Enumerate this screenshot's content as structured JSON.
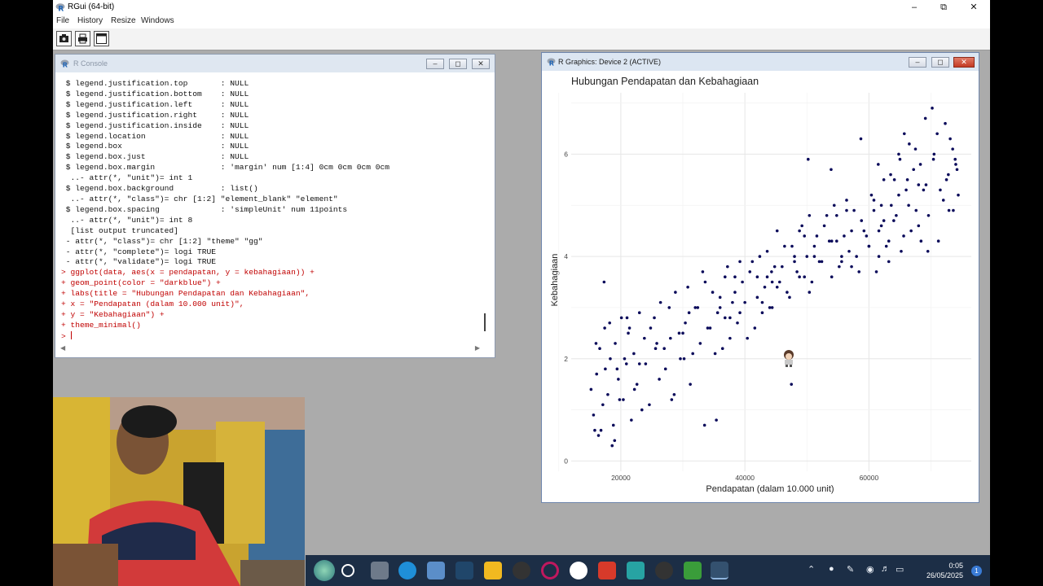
{
  "app": {
    "title": "RGui (64-bit)",
    "menu": [
      "File",
      "History",
      "Resize",
      "Windows"
    ],
    "toolbar_icons": [
      "open-script-icon",
      "print-icon",
      "console-window-icon"
    ]
  },
  "console": {
    "title": "R Console",
    "lines": [
      {
        "text": " $ legend.justification.top       : NULL",
        "kind": "out"
      },
      {
        "text": " $ legend.justification.bottom    : NULL",
        "kind": "out"
      },
      {
        "text": " $ legend.justification.left      : NULL",
        "kind": "out"
      },
      {
        "text": " $ legend.justification.right     : NULL",
        "kind": "out"
      },
      {
        "text": " $ legend.justification.inside    : NULL",
        "kind": "out"
      },
      {
        "text": " $ legend.location                : NULL",
        "kind": "out"
      },
      {
        "text": " $ legend.box                     : NULL",
        "kind": "out"
      },
      {
        "text": " $ legend.box.just                : NULL",
        "kind": "out"
      },
      {
        "text": " $ legend.box.margin              : 'margin' num [1:4] 0cm 0cm 0cm 0cm",
        "kind": "out"
      },
      {
        "text": "  ..- attr(*, \"unit\")= int 1",
        "kind": "out"
      },
      {
        "text": " $ legend.box.background          : list()",
        "kind": "out"
      },
      {
        "text": "  ..- attr(*, \"class\")= chr [1:2] \"element_blank\" \"element\"",
        "kind": "out"
      },
      {
        "text": " $ legend.box.spacing             : 'simpleUnit' num 11points",
        "kind": "out"
      },
      {
        "text": "  ..- attr(*, \"unit\")= int 8",
        "kind": "out"
      },
      {
        "text": "  [list output truncated]",
        "kind": "out"
      },
      {
        "text": " - attr(*, \"class\")= chr [1:2] \"theme\" \"gg\"",
        "kind": "out"
      },
      {
        "text": " - attr(*, \"complete\")= logi TRUE",
        "kind": "out"
      },
      {
        "text": " - attr(*, \"validate\")= logi TRUE",
        "kind": "out"
      },
      {
        "text": "> ggplot(data, aes(x = pendapatan, y = kebahagiaan)) +",
        "kind": "cmd"
      },
      {
        "text": "+ geom_point(color = \"darkblue\") +",
        "kind": "cmd"
      },
      {
        "text": "+ labs(title = \"Hubungan Pendapatan dan Kebahagiaan\",",
        "kind": "cmd"
      },
      {
        "text": "+ x = \"Pendapatan (dalam 10.000 unit)\",",
        "kind": "cmd"
      },
      {
        "text": "+ y = \"Kebahagiaan\") +",
        "kind": "cmd"
      },
      {
        "text": "+ theme_minimal()",
        "kind": "cmd"
      }
    ],
    "prompt": "> "
  },
  "graphics": {
    "title": "R Graphics: Device 2 (ACTIVE)"
  },
  "chart_data": {
    "type": "scatter",
    "title": "Hubungan Pendapatan dan Kebahagiaan",
    "xlabel": "Pendapatan (dalam 10.000 unit)",
    "ylabel": "Kebahagiaan",
    "xlim": [
      12000,
      76500
    ],
    "ylim": [
      -0.2,
      7.2
    ],
    "xticks": [
      20000,
      40000,
      60000
    ],
    "xtick_labels": [
      "20000",
      "40000",
      "60000"
    ],
    "yticks": [
      0,
      2,
      4,
      6
    ],
    "ytick_labels": [
      "0",
      "2",
      "4",
      "6"
    ],
    "point_color": "#0a0a5a",
    "grid": true,
    "series": [
      {
        "x": [
          15200,
          15600,
          16100,
          16600,
          17100,
          17400,
          17900,
          18300,
          18800,
          19100,
          19600,
          20100,
          20400,
          20900,
          21200,
          21700,
          22100,
          22600,
          23000,
          23400,
          16000,
          16800,
          17500,
          18200,
          19000,
          19800,
          20600,
          21400,
          22200,
          23000,
          23800,
          24600,
          25400,
          26200,
          27000,
          27800,
          28600,
          29400,
          30200,
          31000,
          24000,
          24800,
          25600,
          26400,
          27200,
          28000,
          28800,
          29600,
          30400,
          31200,
          32000,
          32800,
          33600,
          34400,
          35200,
          36000,
          36800,
          37600,
          38400,
          39200,
          30000,
          30800,
          31600,
          32400,
          33200,
          34000,
          34800,
          35600,
          36400,
          37200,
          38000,
          38800,
          39600,
          40400,
          41200,
          42000,
          42800,
          43600,
          44400,
          45200,
          36000,
          36800,
          37600,
          38400,
          39200,
          40000,
          40800,
          41600,
          42400,
          43200,
          44000,
          44800,
          45600,
          46400,
          47200,
          48000,
          48800,
          49600,
          50400,
          51200,
          42000,
          42800,
          43600,
          44400,
          45200,
          46000,
          46800,
          47600,
          48400,
          49200,
          50000,
          50800,
          51600,
          52400,
          53200,
          54000,
          54800,
          55600,
          56400,
          57200,
          48000,
          48800,
          49600,
          50400,
          51200,
          52000,
          52800,
          53600,
          54400,
          55200,
          56000,
          56800,
          57600,
          58400,
          59200,
          60000,
          60800,
          61600,
          62400,
          63200,
          54000,
          54800,
          55600,
          56400,
          57200,
          58000,
          58800,
          59600,
          60400,
          61200,
          62000,
          62800,
          63600,
          64400,
          65200,
          66000,
          66800,
          67600,
          68400,
          69200,
          60000,
          60800,
          61600,
          62400,
          63200,
          64000,
          64800,
          65600,
          66400,
          67200,
          68000,
          68800,
          69600,
          70400,
          71200,
          72000,
          72800,
          73600,
          74000,
          74400,
          62000,
          63500,
          65000,
          66500,
          68000,
          69500,
          71000,
          72500,
          73500,
          74200,
          70500,
          71500,
          72300,
          73100,
          73900,
          67500,
          68300,
          69100,
          66200,
          64800,
          16400,
          18600,
          21000,
          25800,
          28200,
          33500,
          35400,
          47500,
          44300,
          50200,
          53900,
          58700,
          61500,
          64100,
          65700,
          70200,
          72900,
          15800,
          17300,
          19400
        ],
        "y": [
          1.4,
          0.9,
          1.7,
          2.2,
          1.1,
          2.6,
          1.3,
          2.0,
          0.7,
          2.3,
          1.6,
          2.8,
          1.2,
          1.9,
          2.5,
          0.8,
          2.1,
          1.5,
          2.9,
          1.0,
          2.3,
          0.6,
          1.8,
          2.7,
          0.4,
          1.2,
          2.0,
          2.6,
          1.4,
          1.9,
          2.4,
          1.1,
          2.8,
          1.6,
          2.2,
          3.0,
          1.3,
          2.5,
          2.0,
          2.9,
          1.9,
          2.6,
          2.2,
          3.1,
          1.8,
          2.4,
          3.3,
          2.0,
          2.7,
          1.5,
          3.0,
          2.3,
          3.5,
          2.6,
          2.1,
          3.2,
          2.8,
          2.4,
          3.6,
          2.9,
          2.5,
          3.4,
          2.1,
          3.0,
          3.7,
          2.6,
          3.3,
          2.9,
          2.2,
          3.8,
          3.1,
          2.7,
          3.5,
          2.4,
          3.9,
          3.2,
          2.9,
          3.6,
          3.0,
          3.4,
          3.0,
          3.6,
          2.8,
          3.3,
          3.9,
          3.1,
          3.7,
          2.6,
          4.0,
          3.4,
          3.0,
          3.8,
          3.5,
          4.2,
          3.2,
          3.9,
          3.6,
          4.4,
          3.3,
          4.0,
          3.6,
          3.1,
          4.1,
          3.5,
          4.5,
          3.8,
          3.3,
          4.2,
          3.7,
          4.6,
          4.0,
          3.5,
          4.4,
          3.9,
          4.8,
          3.6,
          4.3,
          4.0,
          4.9,
          3.8,
          4.0,
          4.5,
          3.6,
          4.8,
          4.2,
          3.9,
          4.6,
          4.3,
          5.0,
          3.8,
          4.4,
          4.1,
          4.9,
          3.7,
          4.5,
          4.2,
          5.1,
          4.0,
          4.7,
          4.3,
          4.3,
          4.8,
          3.9,
          5.1,
          4.5,
          4.0,
          4.7,
          4.4,
          5.2,
          3.7,
          4.6,
          4.2,
          5.0,
          4.8,
          4.1,
          5.3,
          4.5,
          4.9,
          4.3,
          5.4,
          4.2,
          4.9,
          4.5,
          5.5,
          3.9,
          4.7,
          5.2,
          4.4,
          5.0,
          5.7,
          4.6,
          5.3,
          4.8,
          5.9,
          4.3,
          5.1,
          5.6,
          4.9,
          5.8,
          5.2,
          5.0,
          5.6,
          5.9,
          6.2,
          5.4,
          4.1,
          6.4,
          5.5,
          6.1,
          5.7,
          6.0,
          5.3,
          6.6,
          6.3,
          5.9,
          6.1,
          5.8,
          6.7,
          5.5,
          6.0,
          0.5,
          0.3,
          2.8,
          2.3,
          1.2,
          0.7,
          0.8,
          1.5,
          3.7,
          5.9,
          5.7,
          6.3,
          5.8,
          5.5,
          6.4,
          6.9,
          4.9,
          0.6,
          3.5,
          1.8
        ]
      }
    ]
  }
}
